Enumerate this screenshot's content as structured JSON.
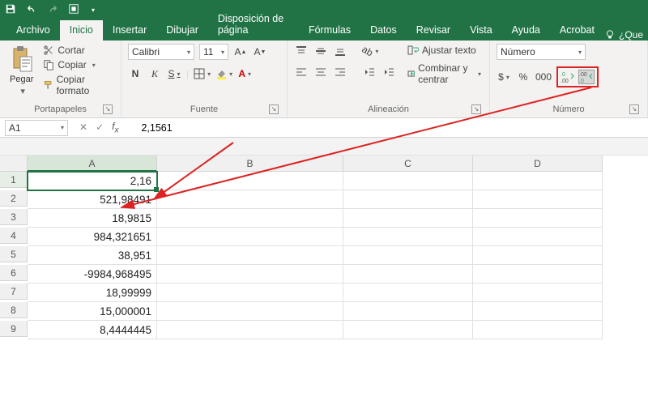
{
  "qat": {
    "save": "",
    "undo": "",
    "redo": ""
  },
  "tabs": {
    "file": "Archivo",
    "home": "Inicio",
    "insert": "Insertar",
    "draw": "Dibujar",
    "layout": "Disposición de página",
    "formulas": "Fórmulas",
    "data": "Datos",
    "review": "Revisar",
    "view": "Vista",
    "help": "Ayuda",
    "acrobat": "Acrobat",
    "tellme": "¿Que"
  },
  "clipboard": {
    "paste": "Pegar",
    "cut": "Cortar",
    "copy": "Copiar",
    "format_painter": "Copiar formato",
    "group": "Portapapeles"
  },
  "font": {
    "name": "Calibri",
    "size": "11",
    "bold": "N",
    "italic": "K",
    "underline": "S",
    "group": "Fuente"
  },
  "alignment": {
    "wrap": "Ajustar texto",
    "merge": "Combinar y centrar",
    "group": "Alineación"
  },
  "number": {
    "format": "Número",
    "currency": "$",
    "percent": "%",
    "thousands": "000",
    "inc_label": ".0→.00",
    "dec_label": ".00→.0",
    "group": "Número"
  },
  "namebox": "A1",
  "formula_value": "2,1561",
  "columns": [
    "A",
    "B",
    "C",
    "D"
  ],
  "rows": [
    {
      "n": "1",
      "a": "2,16"
    },
    {
      "n": "2",
      "a": "521,98491"
    },
    {
      "n": "3",
      "a": "18,9815"
    },
    {
      "n": "4",
      "a": "984,321651"
    },
    {
      "n": "5",
      "a": "38,951"
    },
    {
      "n": "6",
      "a": "-9984,968495"
    },
    {
      "n": "7",
      "a": "18,99999"
    },
    {
      "n": "8",
      "a": "15,000001"
    },
    {
      "n": "9",
      "a": "8,4444445"
    }
  ]
}
